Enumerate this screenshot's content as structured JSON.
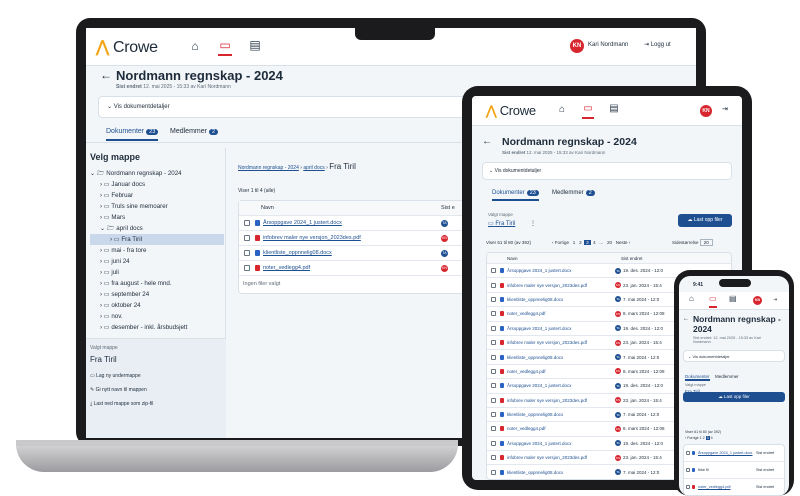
{
  "brand": {
    "name": "Crowe",
    "accent": "#d8262f",
    "primary": "#1d4f91"
  },
  "nav": {
    "icons": [
      "home-icon",
      "folder-icon",
      "clipboard-icon"
    ]
  },
  "user": {
    "initials": "KN",
    "name": "Kari Nordmann",
    "logout": "Logg ut"
  },
  "page": {
    "title": "Nordmann regnskap - 2024",
    "last_changed_label": "Sist endret",
    "last_changed": "12. mai 2025 - 15:33 av Kari Nordmann",
    "details_toggle": "Vis dokumentdetaljer"
  },
  "tabs": [
    {
      "label": "Dokumenter",
      "count": "23"
    },
    {
      "label": "Medlemmer",
      "count": "2"
    }
  ],
  "sidebar": {
    "title": "Velg mappe",
    "tree": [
      {
        "label": "Nordmann regnskap - 2024"
      },
      {
        "label": "Januar docs"
      },
      {
        "label": "Februar"
      },
      {
        "label": "Truls sine memoarer"
      },
      {
        "label": "Mars"
      },
      {
        "label": "april docs"
      },
      {
        "label": "Fra Tiril"
      },
      {
        "label": "mai - fra tore"
      },
      {
        "label": "juni 24"
      },
      {
        "label": "juli"
      },
      {
        "label": "fra august - hele mnd."
      },
      {
        "label": "september 24"
      },
      {
        "label": "oktober 24"
      },
      {
        "label": "nov."
      },
      {
        "label": "desember - inkl. årsbudsjett"
      }
    ],
    "selected_label": "Valgt mappe",
    "selected": "Fra Tiril",
    "actions": [
      "Lag ny undermappe",
      "Gi nytt navn til mappen",
      "Last ned mappe som zip-fil"
    ]
  },
  "breadcrumb": [
    "Nordmann regnskap - 2024",
    "april docs",
    "Fra Tiril"
  ],
  "laptop_list": {
    "count": "Viser 1 til 4 (alle)",
    "col_name": "Navn",
    "col_changed": "Sist e",
    "rows": [
      {
        "name": "Årsoppgave 2024_1 justert.docx",
        "type": "w",
        "by": "TA"
      },
      {
        "name": "infobrev maler nye versjon_2023des.pdf",
        "type": "p",
        "by": "KN"
      },
      {
        "name": "klientliste_oppnnelig08.docx",
        "type": "w",
        "by": "TA"
      },
      {
        "name": "noter_vedlegg4.pdf",
        "type": "p",
        "by": "KN"
      }
    ],
    "footer": "Ingen filer valgt"
  },
  "tablet": {
    "upload": "Last opp filer",
    "count": "Viser 61 til 80 (av 392)",
    "prev": "Forrige",
    "next": "Neste",
    "pages": [
      "1",
      "2",
      "3",
      "4",
      "...",
      "20"
    ],
    "page_size_label": "Sidestørrelse",
    "page_size": "20",
    "col_name": "Navn",
    "col_changed": "Sist endret",
    "rows": [
      {
        "name": "Årsoppgave 2024_1 justert.docx",
        "type": "w",
        "by": "TA",
        "date": "19. des. 2024 - 12:0"
      },
      {
        "name": "infobrev maler nye versjon_2023des.pdf",
        "type": "p",
        "by": "KN",
        "date": "23. jan. 2024 - 15:4"
      },
      {
        "name": "klientliste_oppnnelig08.docx",
        "type": "w",
        "by": "TA",
        "date": "7. mai 2024 - 12:0"
      },
      {
        "name": "noter_vedlegg4.pdf",
        "type": "p",
        "by": "KN",
        "date": "8. mars 2024 - 12:08"
      },
      {
        "name": "Årsoppgave 2024_1 justert.docx",
        "type": "w",
        "by": "TA",
        "date": "19. des. 2024 - 12:0"
      },
      {
        "name": "infobrev maler nye versjon_2023des.pdf",
        "type": "p",
        "by": "KN",
        "date": "23. jan. 2024 - 15:4"
      },
      {
        "name": "klientliste_oppnnelig08.docx",
        "type": "w",
        "by": "TA",
        "date": "7. mai 2024 - 12:0"
      },
      {
        "name": "noter_vedlegg4.pdf",
        "type": "p",
        "by": "KN",
        "date": "8. mars 2024 - 12:08"
      },
      {
        "name": "Årsoppgave 2024_1 justert.docx",
        "type": "w",
        "by": "TA",
        "date": "19. des. 2024 - 12:0"
      },
      {
        "name": "infobrev maler nye versjon_2023des.pdf",
        "type": "p",
        "by": "KN",
        "date": "23. jan. 2024 - 15:4"
      },
      {
        "name": "klientliste_oppnnelig08.docx",
        "type": "w",
        "by": "TA",
        "date": "7. mai 2024 - 12:0"
      },
      {
        "name": "noter_vedlegg4.pdf",
        "type": "p",
        "by": "KN",
        "date": "8. mars 2024 - 12:08"
      },
      {
        "name": "Årsoppgave 2024_1 justert.docx",
        "type": "w",
        "by": "TA",
        "date": "19. des. 2024 - 12:0"
      },
      {
        "name": "infobrev maler nye versjon_2023des.pdf",
        "type": "p",
        "by": "KN",
        "date": "23. jan. 2024 - 15:4"
      },
      {
        "name": "klientliste_oppnnelig08.docx",
        "type": "w",
        "by": "TA",
        "date": "7. mai 2024 - 12:0"
      }
    ]
  },
  "phone": {
    "time": "9:41",
    "title": "Nordmann regnskap - 2024",
    "last_changed": "Sist endret: 12. mai 2025 - 15:33 av Kari Nordmann",
    "count": "Viser 61 til 80 (av 392)",
    "rows": [
      {
        "name": "Årsoppgave 2024_1 justert.docx",
        "changed": "Sist endret"
      },
      {
        "name": "Ikke fil",
        "changed": "Sist endret"
      },
      {
        "name": "noter_vedlegg4.pdf",
        "changed": "Sist endret"
      }
    ]
  }
}
